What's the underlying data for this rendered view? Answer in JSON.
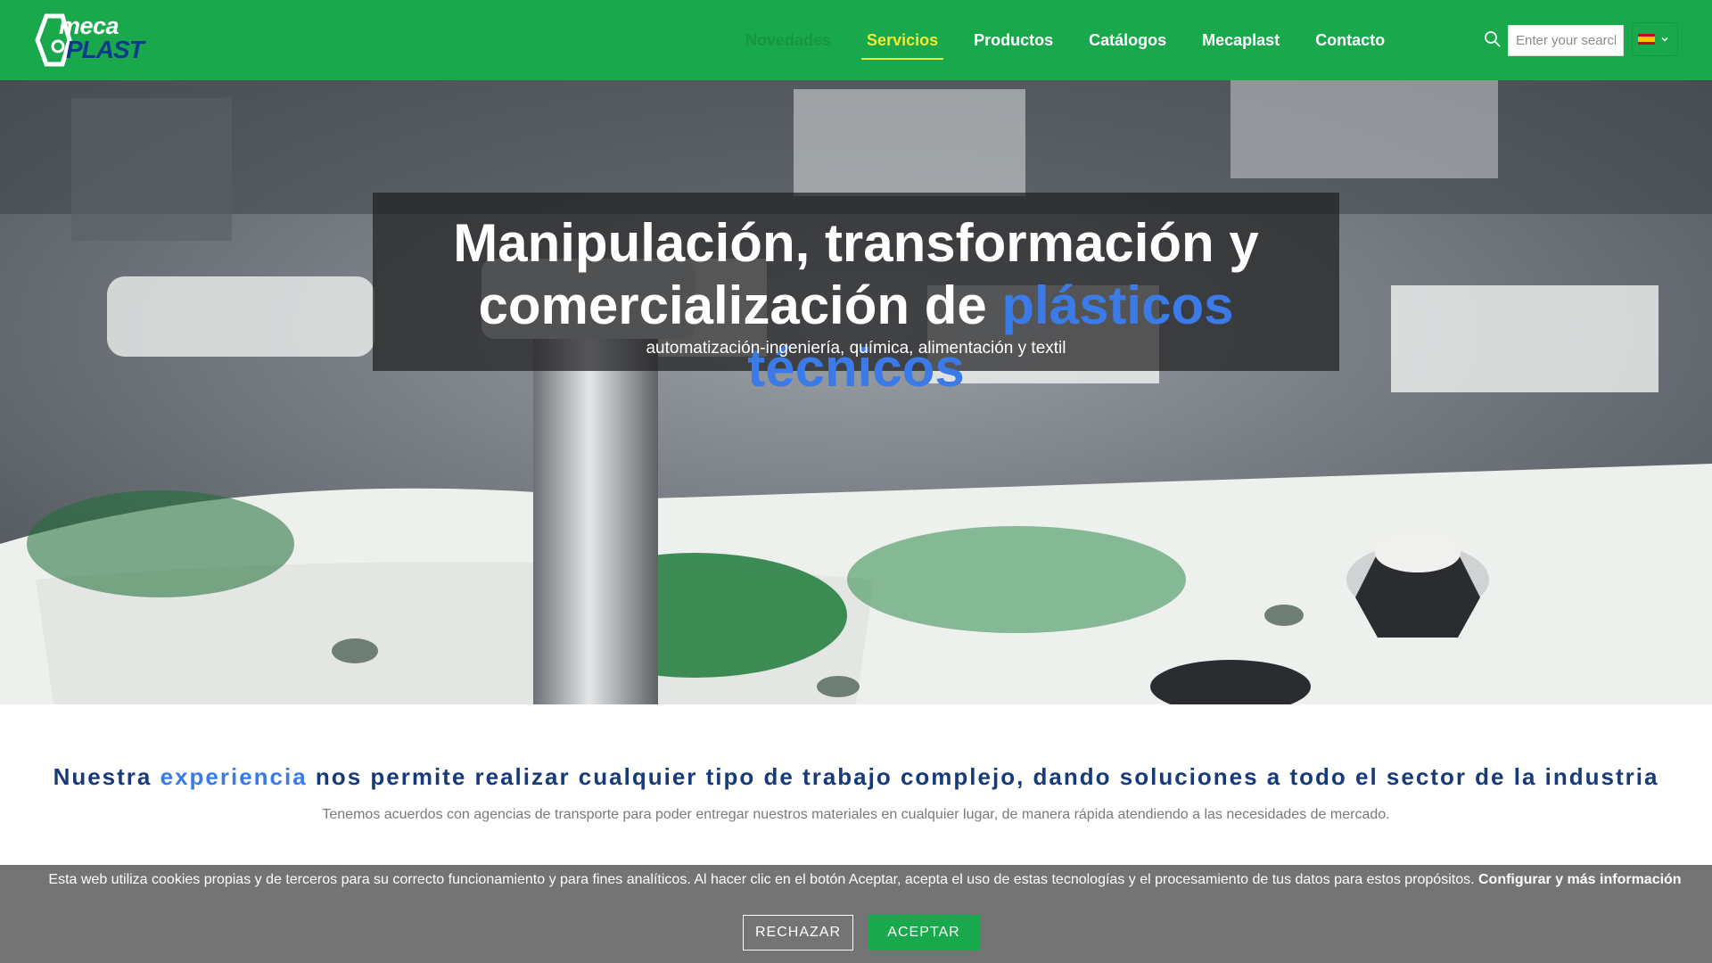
{
  "brand": {
    "logo_top": "meca",
    "logo_bottom": "PLAST",
    "colors": {
      "header_bg": "#1aa84c",
      "accent_yellow": "#f2e836",
      "accent_blue": "#3a7be8",
      "navy": "#173a78"
    }
  },
  "nav": {
    "items": [
      {
        "label": "Novedades",
        "state": "faded"
      },
      {
        "label": "Servicios",
        "state": "active"
      },
      {
        "label": "Productos",
        "state": "normal"
      },
      {
        "label": "Catálogos",
        "state": "normal"
      },
      {
        "label": "Mecaplast",
        "state": "normal"
      },
      {
        "label": "Contacto",
        "state": "normal"
      }
    ]
  },
  "search": {
    "placeholder": "Enter your search",
    "icon": "search-icon"
  },
  "language": {
    "selected_flag": "es-flag"
  },
  "hero": {
    "title_line1": "Manipulación, transformación y",
    "title_line2_plain": "comercialización de ",
    "title_line2_highlight": "plásticos técnicos",
    "subtitle": "automatización-ingeniería, química, alimentación y textil"
  },
  "section": {
    "headline_pre": "Nuestra ",
    "headline_strong": "experiencia",
    "headline_post": " nos permite realizar cualquier tipo de trabajo complejo, dando soluciones a todo el sector de la industria",
    "subline": "Tenemos acuerdos con agencias de transporte para poder entregar nuestros materiales en cualquier lugar, de manera rápida atendiendo a las necesidades de mercado."
  },
  "cookie": {
    "text": "Esta web utiliza cookies propias y de terceros para su correcto funcionamiento y para fines analíticos. Al hacer clic en el botón Aceptar, acepta el uso de estas tecnologías y el procesamiento de tus datos para estos propósitos.",
    "link": "Configurar y más información",
    "reject_label": "RECHAZAR",
    "accept_label": "ACEPTAR"
  }
}
